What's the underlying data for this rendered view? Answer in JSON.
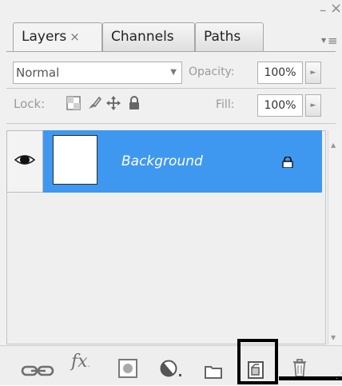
{
  "tabs": [
    {
      "label": "Layers",
      "close": "×",
      "active": true
    },
    {
      "label": "Channels",
      "active": false
    },
    {
      "label": "Paths",
      "active": false
    }
  ],
  "window": {
    "minimize": "–",
    "close": "×"
  },
  "blend": {
    "mode": "Normal",
    "opacity_label": "Opacity:",
    "opacity_value": "100%"
  },
  "lock": {
    "label": "Lock:",
    "fill_label": "Fill:",
    "fill_value": "100%"
  },
  "layers": [
    {
      "name": "Background",
      "visible": true,
      "locked": true,
      "selected": true
    }
  ],
  "toolbar": {
    "icons": [
      "link-layers-icon",
      "layer-style-fx-icon",
      "layer-mask-icon",
      "adjustment-layer-icon",
      "new-group-icon",
      "new-layer-icon",
      "delete-layer-icon"
    ],
    "fx_label": "fx",
    "highlighted": "new-layer-icon"
  },
  "colors": {
    "selection": "#3f98f0",
    "highlight_border": "#000000"
  }
}
